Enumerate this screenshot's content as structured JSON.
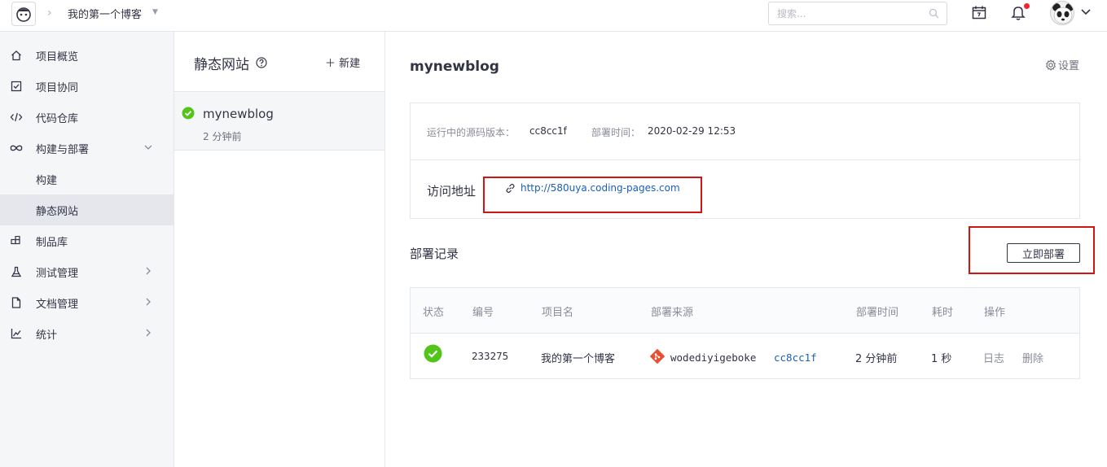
{
  "topbar": {
    "project_name": "我的第一个博客",
    "search_placeholder": "搜索..."
  },
  "sidebar": {
    "items": [
      {
        "label": "项目概览",
        "icon": "home-icon"
      },
      {
        "label": "项目协同",
        "icon": "checkbox-icon"
      },
      {
        "label": "代码仓库",
        "icon": "code-icon"
      },
      {
        "label": "构建与部署",
        "icon": "infinity-icon",
        "expanded": true
      },
      {
        "label": "构建"
      },
      {
        "label": "静态网站",
        "active": true
      },
      {
        "label": "制品库",
        "icon": "package-icon"
      },
      {
        "label": "测试管理",
        "icon": "flask-icon"
      },
      {
        "label": "文档管理",
        "icon": "document-icon"
      },
      {
        "label": "统计",
        "icon": "chart-icon"
      }
    ]
  },
  "list": {
    "title": "静态网站",
    "new_label": "新建",
    "site": {
      "name": "mynewblog",
      "time": "2 分钟前"
    }
  },
  "main": {
    "title": "mynewblog",
    "settings_label": "设置",
    "info": {
      "version_key": "运行中的源码版本：",
      "version_value": "cc8cc1f",
      "deploy_time_key": "部署时间：",
      "deploy_time_value": "2020-02-29 12:53",
      "visit_label": "访问地址",
      "visit_url": "http://580uya.coding-pages.com"
    },
    "records_title": "部署记录",
    "deploy_button": "立即部署",
    "table": {
      "headers": [
        "状态",
        "编号",
        "项目名",
        "部署来源",
        "部署时间",
        "耗时",
        "操作"
      ],
      "row": {
        "id": "233275",
        "project": "我的第一个博客",
        "source_repo": "wodediyigeboke",
        "source_commit": "cc8cc1f",
        "deploy_time": "2 分钟前",
        "duration": "1 秒",
        "action_log": "日志",
        "action_delete": "删除"
      }
    }
  },
  "colors": {
    "success": "#52c41a",
    "link": "#1b5fb7",
    "highlight": "#d01515",
    "notification": "#f5222d",
    "git": "#e84e31"
  }
}
